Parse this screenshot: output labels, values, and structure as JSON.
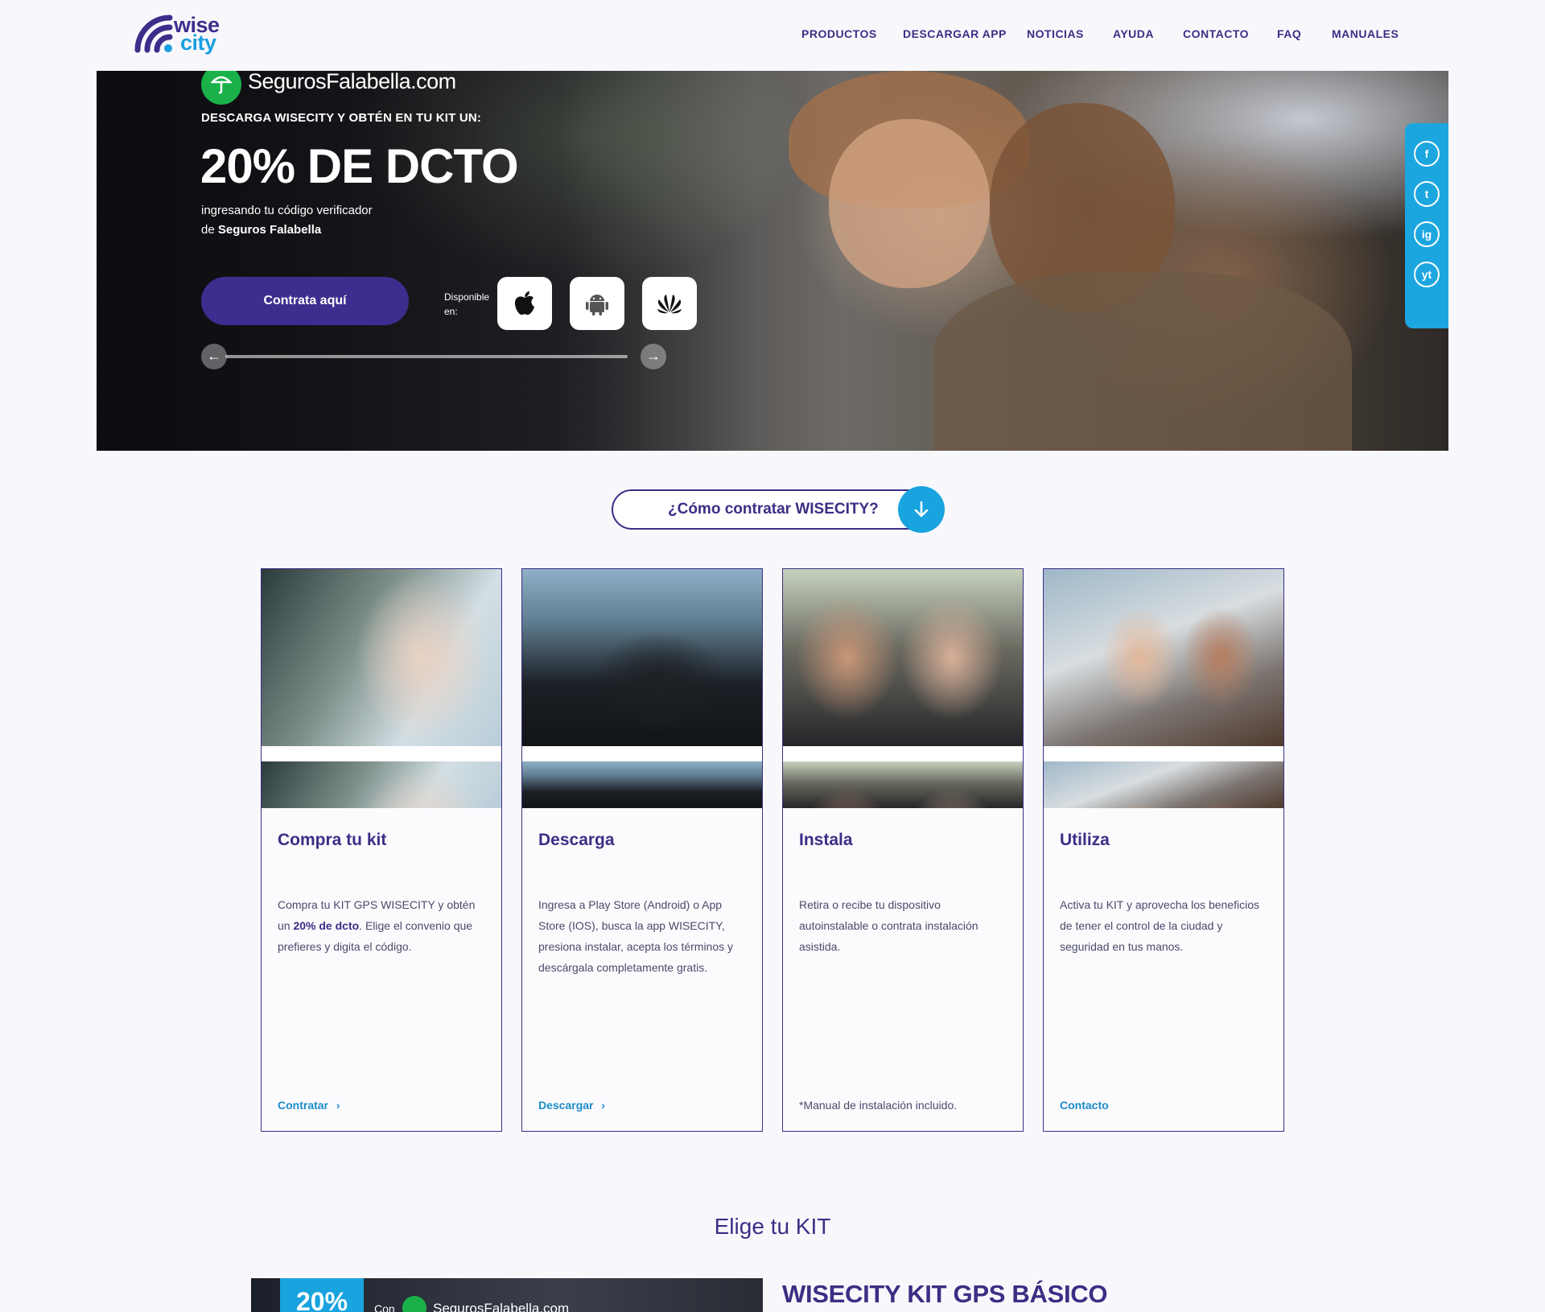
{
  "brand": {
    "logo_line1": "wise",
    "logo_line2": "city"
  },
  "nav": [
    "PRODUCTOS",
    "DESCARGAR APP",
    "NOTICIAS",
    "AYUDA",
    "CONTACTO",
    "FAQ",
    "MANUALES"
  ],
  "hero": {
    "partner_logo_text": "SegurosFalabella.com",
    "kicker": "DESCARGA WISECITY Y OBTÉN EN TU KIT UN:",
    "title": "20% DE DCTO",
    "subtitle_line1": "ingresando tu código verificador",
    "subtitle_line2_prefix": "de",
    "subtitle_line2_bold": "Seguros Falabella",
    "cta_label": "Contrata aquí",
    "available_label": "Disponible en:",
    "stores": [
      "apple-icon",
      "android-icon",
      "huawei-icon"
    ],
    "social": [
      "f",
      "t",
      "ig",
      "yt"
    ]
  },
  "howto": {
    "label": "¿Cómo contratar WISECITY?"
  },
  "steps": [
    {
      "title": "Compra tu kit",
      "desc_before": "Compra tu KIT GPS WISECITY y obtén un",
      "desc_bold": "20% de dcto",
      "desc_after": ". Elige el convenio que prefieres y digita el código.",
      "link": "Contratar",
      "link_arrow": "›"
    },
    {
      "title": "Descarga",
      "desc_before": "Ingresa a Play Store (Android) o App Store (IOS), busca la app WISECITY, presiona instalar, acepta los términos y descárgala completamente gratis.",
      "link": "Descargar",
      "link_arrow": "›"
    },
    {
      "title": "Instala",
      "desc_before": "Retira o recibe tu dispositivo autoinstalable o contrata instalación asistida.",
      "note": "*Manual de instalación incluido."
    },
    {
      "title": "Utiliza",
      "desc_before": "Activa tu KIT y aprovecha los beneficios de tener el control de la ciudad y seguridad en tus manos.",
      "link": "Contacto"
    }
  ],
  "kits": {
    "section_title": "Elige tu KIT",
    "badge": "20%",
    "badge_con": "Con",
    "badge_partner": "SegurosFalabella.com",
    "first_kit_title": "WISECITY KIT GPS BÁSICO"
  },
  "colors": {
    "primary": "#3a2f85",
    "accent": "#19a3df",
    "partner_green": "#1bb14a",
    "background": "#f8f8fc"
  }
}
